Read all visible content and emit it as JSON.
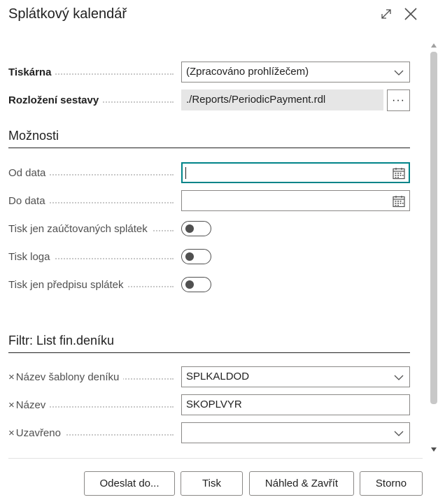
{
  "dialog": {
    "title": "Splátkový kalendář",
    "expand_icon": "expand-icon",
    "close_icon": "close-icon"
  },
  "printer": {
    "label": "Tiskárna",
    "value": "(Zpracováno prohlížečem)"
  },
  "layout": {
    "label": "Rozložení sestavy",
    "value": "./Reports/PeriodicPayment.rdl",
    "button_label": "···"
  },
  "options": {
    "title": "Možnosti",
    "from_date": {
      "label": "Od data",
      "value": ""
    },
    "to_date": {
      "label": "Do data",
      "value": ""
    },
    "print_posted_only": {
      "label": "Tisk jen zaúčtovaných splátek",
      "checked": false
    },
    "print_logo": {
      "label": "Tisk loga",
      "checked": false
    },
    "print_prescription_only": {
      "label": "Tisk jen předpisu splátek",
      "checked": false
    }
  },
  "filter": {
    "title": "Filtr: List fin.deníku",
    "remove_glyph": "×",
    "template_name": {
      "label": "Název šablony deníku",
      "value": "SPLKALDOD"
    },
    "name": {
      "label": "Název",
      "value": "SKOPLVYR"
    },
    "closed": {
      "label": "Uzavřeno",
      "value": ""
    }
  },
  "footer": {
    "send_to": "Odeslat do...",
    "print": "Tisk",
    "preview_close": "Náhled & Zavřít",
    "cancel": "Storno"
  },
  "colors": {
    "focus": "#008489",
    "border": "#8a8886",
    "readonly_bg": "#e6e6e6",
    "text": "#212121",
    "label": "#505050"
  }
}
